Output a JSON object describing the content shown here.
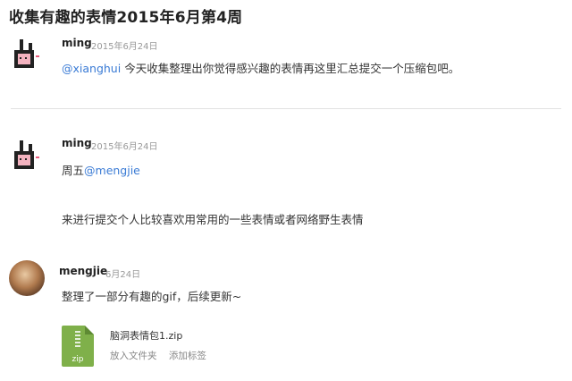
{
  "page": {
    "title": "收集有趣的表情2015年6月第4周"
  },
  "posts": [
    {
      "author": "ming",
      "date": "2015年6月24日",
      "avatar": "pixel-hand-icon",
      "lines": [
        {
          "mention": "@xianghui",
          "text": " 今天收集整理出你觉得感兴趣的表情再这里汇总提交一个压缩包吧。"
        }
      ]
    },
    {
      "author": "ming",
      "date": "2015年6月24日",
      "avatar": "pixel-hand-icon",
      "lines": [
        {
          "prefix": "周五",
          "mention": "@mengjie"
        },
        {
          "text": "来进行提交个人比较喜欢用常用的一些表情或者网络野生表情"
        }
      ]
    },
    {
      "author": "mengjie",
      "date": "6月24日",
      "avatar": "user-photo",
      "lines": [
        {
          "text": "整理了一部分有趣的gif，后续更新~"
        }
      ],
      "attachment": {
        "icon": "zip-file-icon",
        "icon_label": "zip",
        "name": "脑洞表情包1.zip",
        "actions": [
          "放入文件夹",
          "添加标签"
        ]
      }
    }
  ],
  "colors": {
    "mention": "#3a7bd5",
    "zip_icon": "#7fb04a",
    "divider": "#e2e2e2"
  }
}
